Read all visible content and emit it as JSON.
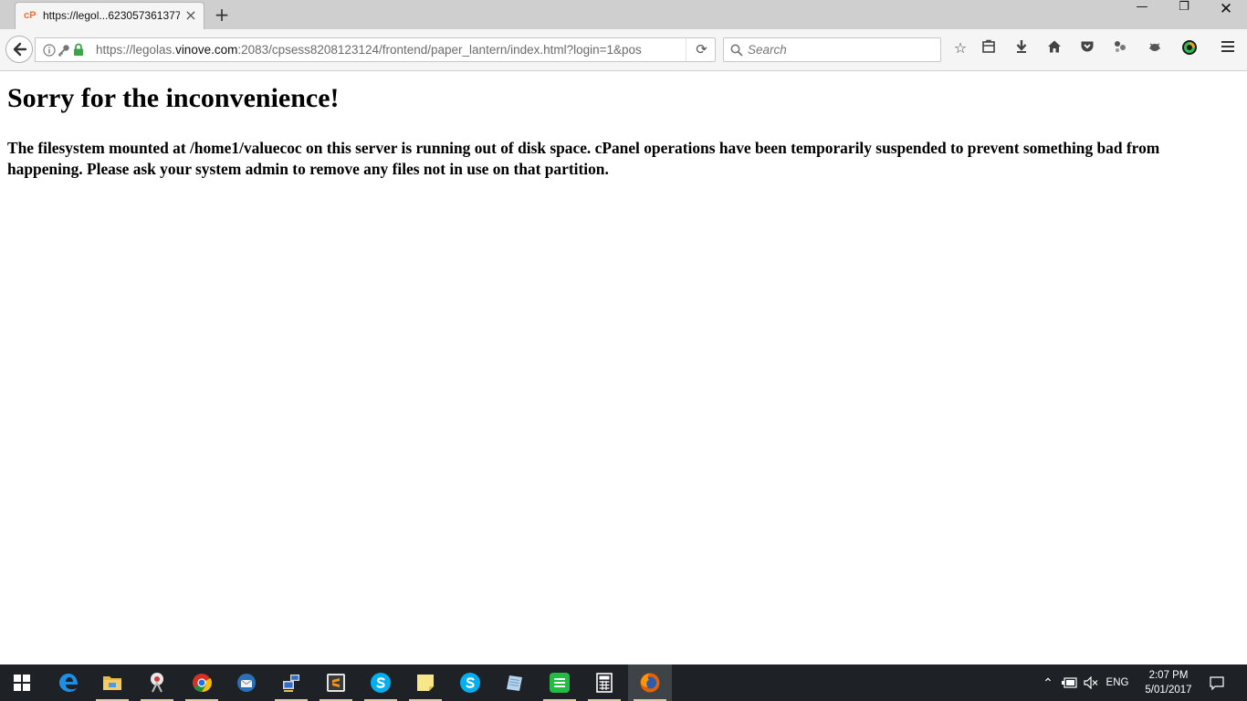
{
  "browser": {
    "tab": {
      "title": "https://legol...623057361377",
      "favicon_text": "cP"
    },
    "url": {
      "prefix": "https://legolas.",
      "host": "vinove.com",
      "rest": ":2083/cpsess8208123124/frontend/paper_lantern/index.html?login=1&pos"
    },
    "search_placeholder": "Search"
  },
  "page": {
    "heading": "Sorry for the inconvenience!",
    "message": "The filesystem mounted at /home1/valuecoc on this server is running out of disk space. cPanel operations have been temporarily suspended to prevent something bad from happening. Please ask your system admin to remove any files not in use on that partition."
  },
  "taskbar": {
    "language": "ENG",
    "time": "2:07 PM",
    "date": "5/01/2017"
  },
  "colors": {
    "taskbar_bg": "#1e2226",
    "tab_strip_bg": "#cfcfcf",
    "cpanel_orange": "#ff6c2c"
  }
}
